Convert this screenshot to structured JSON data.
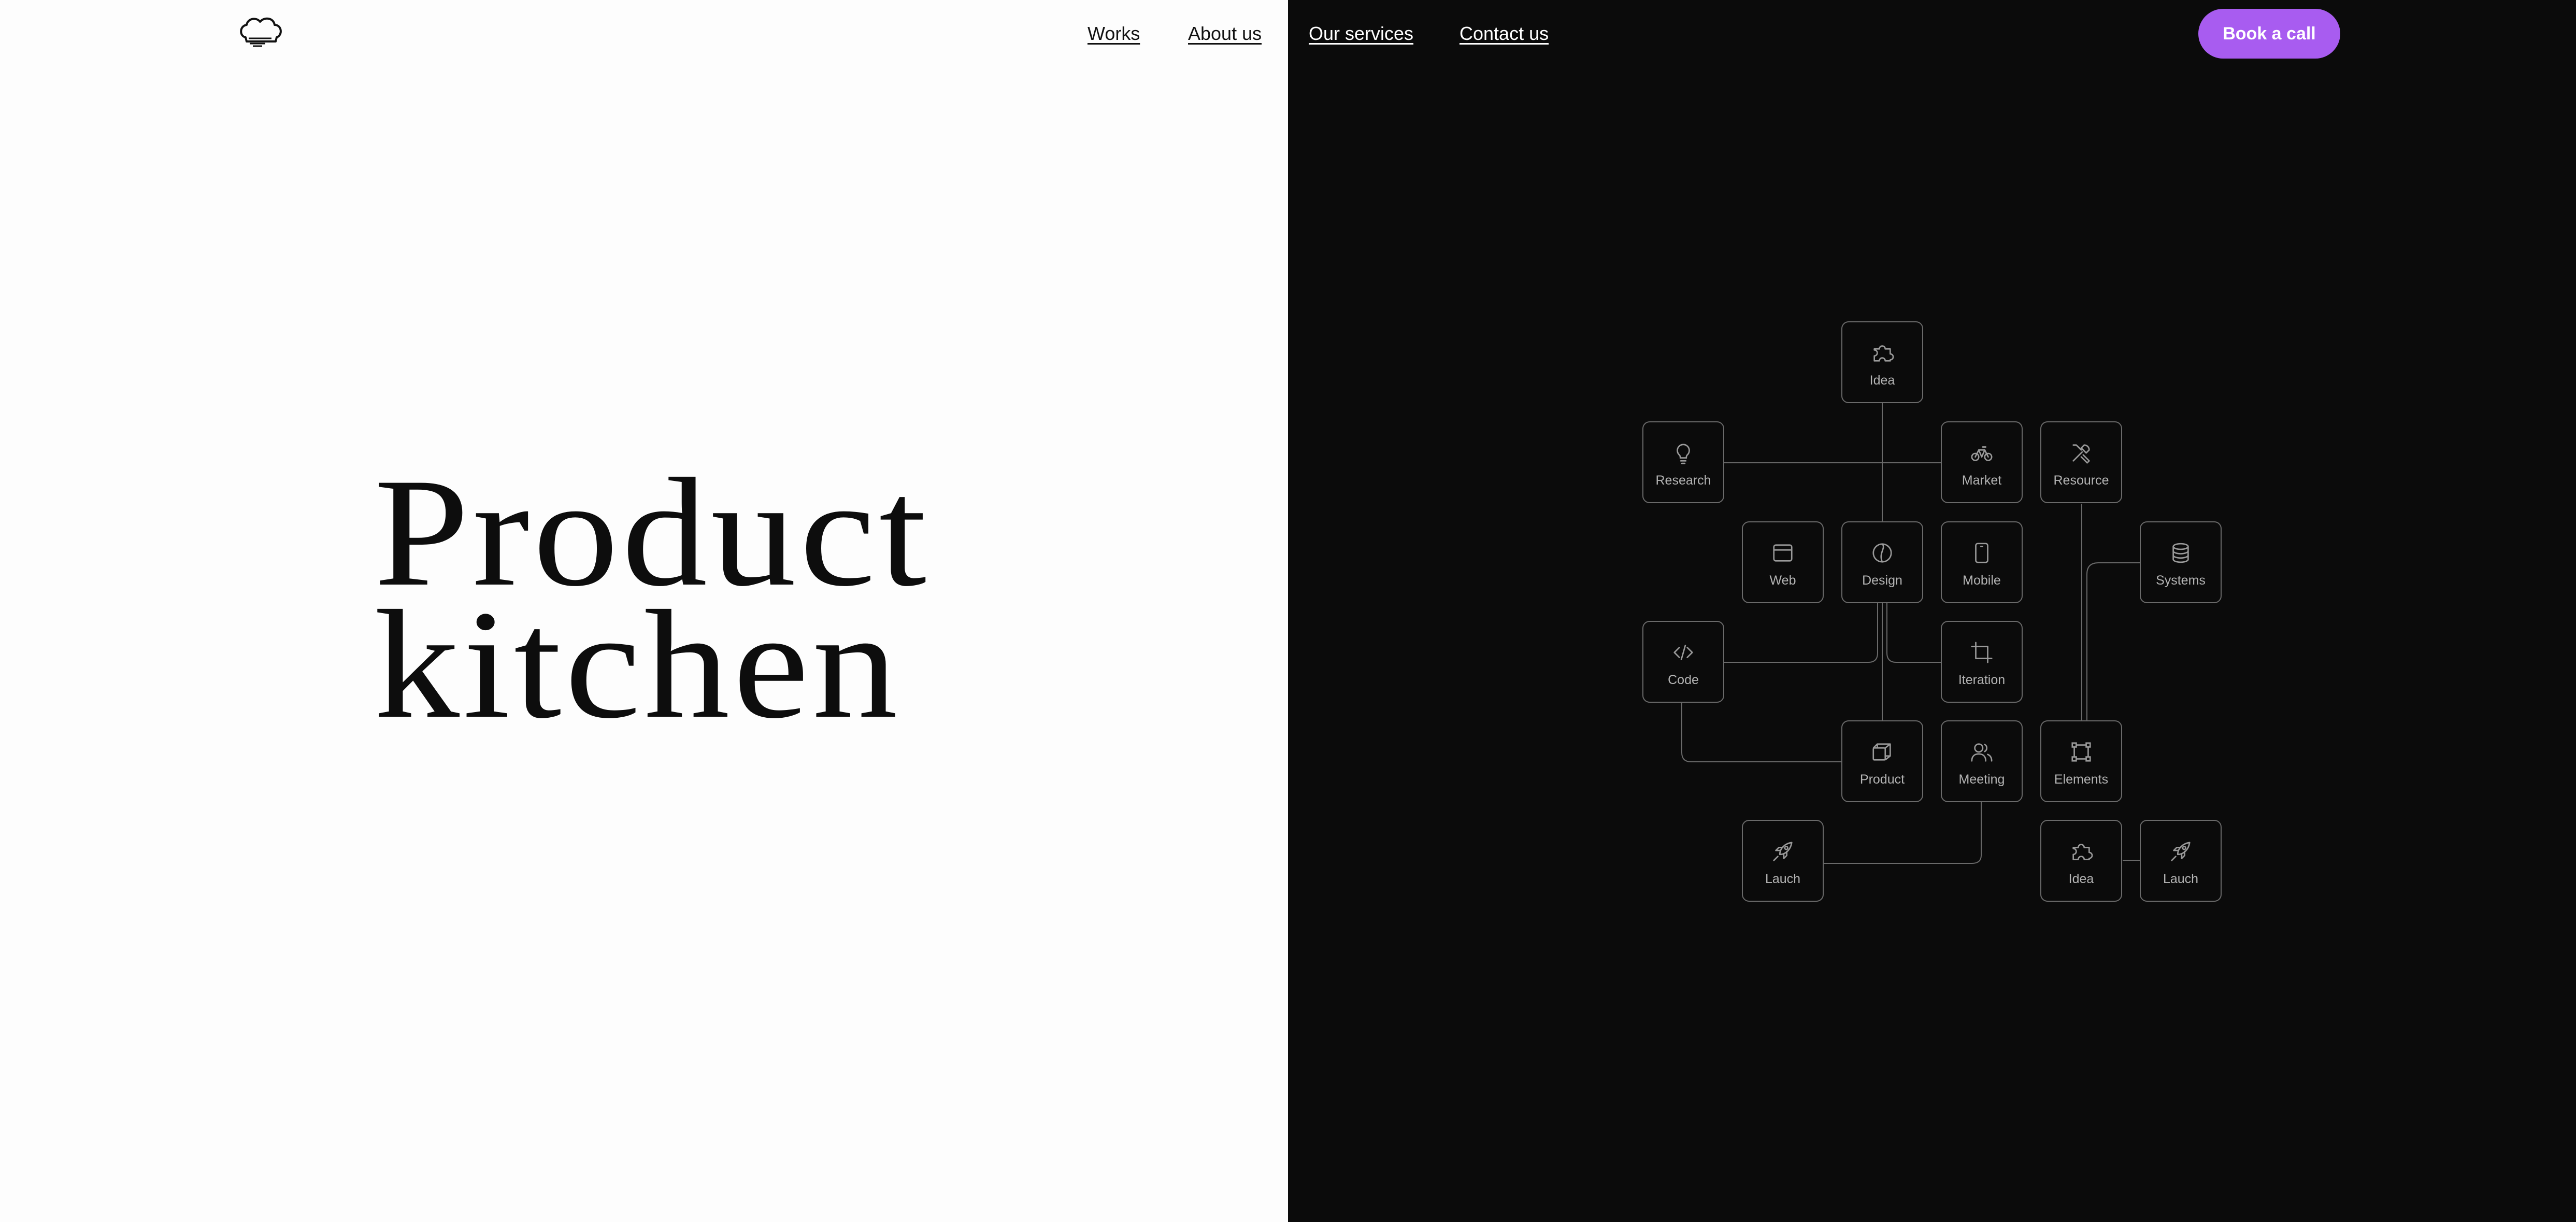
{
  "header": {
    "logo_icon": "chef-hat-icon",
    "nav": {
      "works": "Works",
      "about": "About us",
      "services": "Our services",
      "contact": "Contact us"
    },
    "cta_label": "Book a call",
    "cta_color": "#a85cf0"
  },
  "hero": {
    "title_line1": "Product",
    "title_line2": "kitchen"
  },
  "colors": {
    "left_background": "#fdfdfd",
    "right_background": "#0b0b0b",
    "node_border": "#6a6a6a",
    "node_label": "#b4b4b4"
  },
  "diagram": {
    "nodes": [
      {
        "id": "idea",
        "label": "Idea",
        "icon": "puzzle-icon"
      },
      {
        "id": "research",
        "label": "Research",
        "icon": "lightbulb-icon"
      },
      {
        "id": "market",
        "label": "Market",
        "icon": "bicycle-icon"
      },
      {
        "id": "resource",
        "label": "Resource",
        "icon": "tools-icon"
      },
      {
        "id": "web",
        "label": "Web",
        "icon": "browser-window-icon"
      },
      {
        "id": "design",
        "label": "Design",
        "icon": "palette-circle-icon"
      },
      {
        "id": "mobile",
        "label": "Mobile",
        "icon": "smartphone-icon"
      },
      {
        "id": "systems",
        "label": "Systems",
        "icon": "database-icon"
      },
      {
        "id": "code",
        "label": "Code",
        "icon": "code-icon"
      },
      {
        "id": "iteration",
        "label": "Iteration",
        "icon": "crop-icon"
      },
      {
        "id": "product",
        "label": "Product",
        "icon": "layers-box-icon"
      },
      {
        "id": "meeting",
        "label": "Meeting",
        "icon": "users-icon"
      },
      {
        "id": "elements",
        "label": "Elements",
        "icon": "vector-nodes-icon"
      },
      {
        "id": "launch1",
        "label": "Lauch",
        "icon": "rocket-icon"
      },
      {
        "id": "idea2",
        "label": "Idea",
        "icon": "puzzle-icon"
      },
      {
        "id": "launch2",
        "label": "Lauch",
        "icon": "rocket-icon"
      }
    ]
  }
}
